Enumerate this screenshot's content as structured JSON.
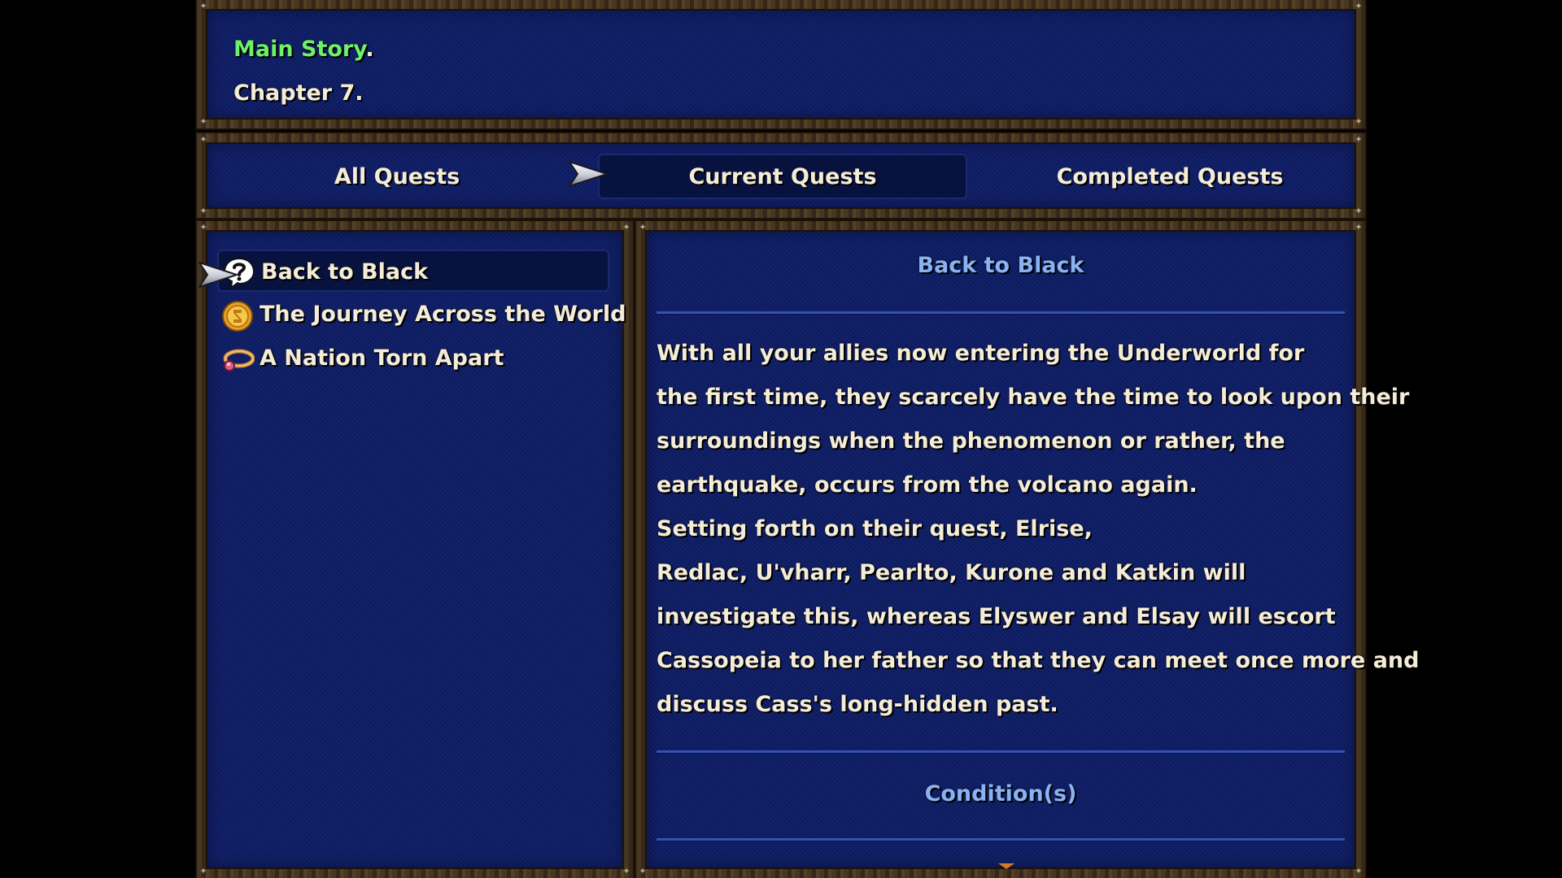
{
  "header": {
    "story_label": "Main Story",
    "story_suffix": ".",
    "chapter": "Chapter 7."
  },
  "tabs": [
    {
      "label": "All Quests",
      "selected": false
    },
    {
      "label": "Current Quests",
      "selected": true
    },
    {
      "label": "Completed Quests",
      "selected": false
    }
  ],
  "quests": [
    {
      "label": "Back to Black",
      "icon": "question-bubble-icon",
      "selected": true
    },
    {
      "label": "The Journey Across the World",
      "icon": "gold-coin-icon",
      "selected": false
    },
    {
      "label": "A Nation Torn Apart",
      "icon": "jeweled-ring-icon",
      "selected": false
    }
  ],
  "detail": {
    "title": "Back to Black",
    "description_lines": [
      "With all your allies now entering the Underworld for",
      "the first time, they scarcely have the time to look upon their",
      "surroundings when the phenomenon or rather, the",
      "earthquake, occurs from the volcano again.",
      "Setting forth on their quest, Elrise,",
      "Redlac, U'vharr, Pearlto, Kurone and Katkin will",
      "investigate this, whereas Elyswer and Elsay will escort",
      "Cassopeia to her father so that they can meet once more and",
      "discuss Cass's long-hidden past."
    ],
    "conditions_label": "Condition(s)"
  },
  "colors": {
    "panel_bg": "#0c1b63",
    "frame": "#3c2d1a",
    "text": "#f4ecd6",
    "story_green": "#6ff06a",
    "heading_blue": "#8ab2f2",
    "divider": "#3552b6"
  }
}
